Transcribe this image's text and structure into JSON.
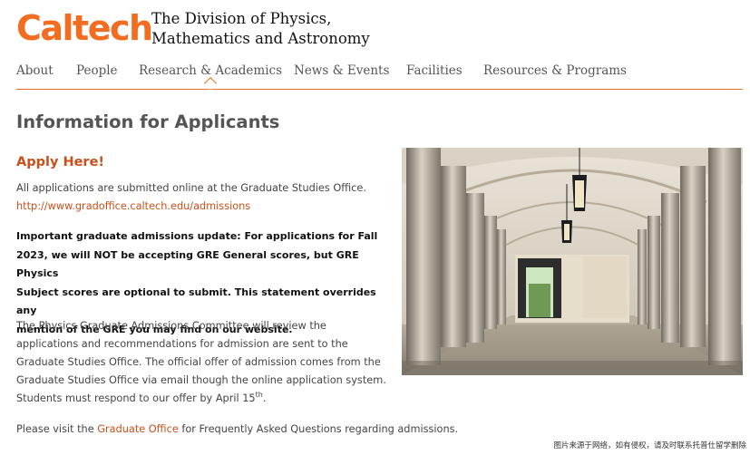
{
  "header": {
    "logo_text": "Caltech",
    "division_line1": "The Division of Physics,",
    "division_line2": "Mathematics and Astronomy",
    "brand_color": "#f36d21"
  },
  "nav": {
    "items": [
      {
        "label": "About"
      },
      {
        "label": "People"
      },
      {
        "label": "Research & Academics",
        "active": true
      },
      {
        "label": "News & Events"
      },
      {
        "label": "Facilities"
      },
      {
        "label": "Resources & Programs"
      }
    ]
  },
  "main": {
    "title": "Information for Applicants",
    "apply_heading": "Apply Here!",
    "intro": "All applications are submitted online at the Graduate Studies Office.",
    "admissions_url": "http://www.gradoffice.caltech.edu/admissions",
    "update_lines": [
      "Important graduate admissions update:  For applications for Fall",
      "2023, we will NOT be accepting GRE General scores, but GRE Physics",
      "Subject scores are optional to submit. This statement overrides any",
      "mention of the GRE you may find on our website."
    ],
    "committee_lines": [
      "The Physics Graduate Admissions Committee will review the",
      "applications and recommendations for admission are sent to the",
      "Graduate Studies Office. The official offer of admission comes from the",
      "Graduate Studies Office via email though the online application system.",
      "Students must respond to our offer by April 15"
    ],
    "committee_sup": "th",
    "committee_end": ".",
    "visit_prefix": "Please visit the ",
    "visit_link": "Graduate Office",
    "visit_suffix": " for Frequently Asked Questions regarding admissions."
  },
  "watermark": "图片来源于网络，如有侵权，请及时联系托普仕留学删除"
}
